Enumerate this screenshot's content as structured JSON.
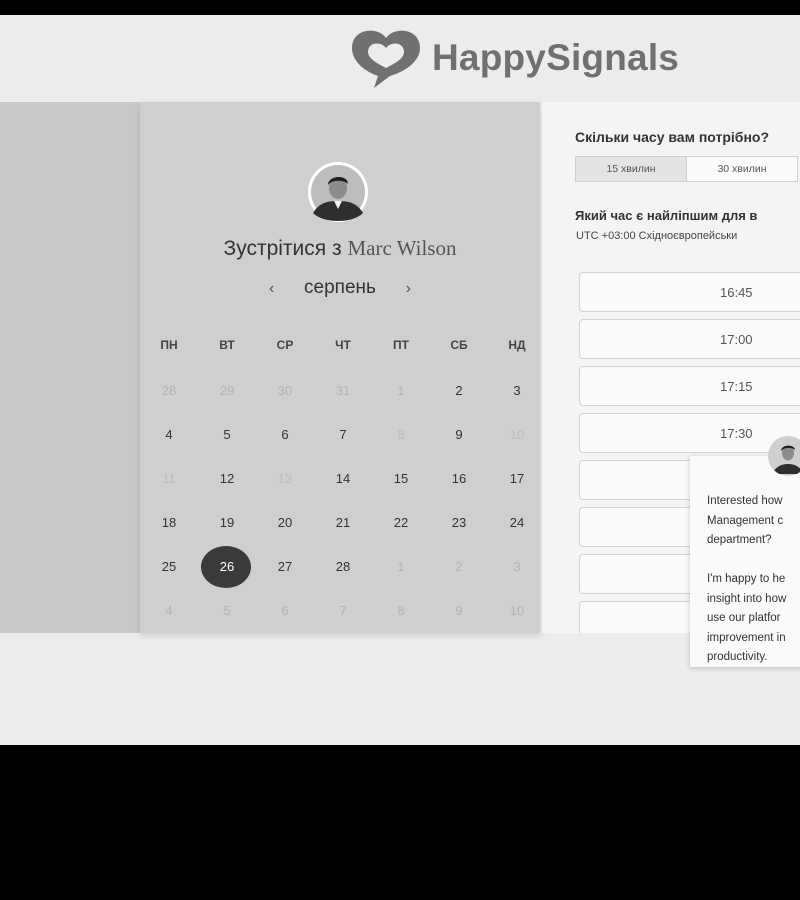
{
  "brand": {
    "name": "HappySignals"
  },
  "calendar": {
    "title_prefix": "Зустрітися з",
    "host_name": "Marc Wilson",
    "month": "серпень",
    "prev_label": "‹",
    "next_label": "›",
    "weekdays": [
      "ПН",
      "ВТ",
      "СР",
      "ЧТ",
      "ПТ",
      "СБ",
      "НД"
    ],
    "weeks": [
      [
        {
          "d": "28",
          "s": "muted"
        },
        {
          "d": "29",
          "s": "muted"
        },
        {
          "d": "30",
          "s": "muted"
        },
        {
          "d": "31",
          "s": "muted"
        },
        {
          "d": "1",
          "s": "muted"
        },
        {
          "d": "2",
          "s": "normal"
        },
        {
          "d": "3",
          "s": "normal"
        }
      ],
      [
        {
          "d": "4",
          "s": "normal"
        },
        {
          "d": "5",
          "s": "normal"
        },
        {
          "d": "6",
          "s": "normal"
        },
        {
          "d": "7",
          "s": "normal"
        },
        {
          "d": "8",
          "s": "disabled"
        },
        {
          "d": "9",
          "s": "normal"
        },
        {
          "d": "10",
          "s": "disabled"
        }
      ],
      [
        {
          "d": "11",
          "s": "disabled"
        },
        {
          "d": "12",
          "s": "normal"
        },
        {
          "d": "13",
          "s": "disabled"
        },
        {
          "d": "14",
          "s": "normal"
        },
        {
          "d": "15",
          "s": "normal"
        },
        {
          "d": "16",
          "s": "normal"
        },
        {
          "d": "17",
          "s": "normal"
        }
      ],
      [
        {
          "d": "18",
          "s": "normal"
        },
        {
          "d": "19",
          "s": "normal"
        },
        {
          "d": "20",
          "s": "normal"
        },
        {
          "d": "21",
          "s": "normal"
        },
        {
          "d": "22",
          "s": "normal"
        },
        {
          "d": "23",
          "s": "normal"
        },
        {
          "d": "24",
          "s": "normal"
        }
      ],
      [
        {
          "d": "25",
          "s": "normal"
        },
        {
          "d": "26",
          "s": "selected"
        },
        {
          "d": "27",
          "s": "normal"
        },
        {
          "d": "28",
          "s": "normal"
        },
        {
          "d": "1",
          "s": "muted"
        },
        {
          "d": "2",
          "s": "muted"
        },
        {
          "d": "3",
          "s": "muted"
        }
      ],
      [
        {
          "d": "4",
          "s": "muted"
        },
        {
          "d": "5",
          "s": "muted"
        },
        {
          "d": "6",
          "s": "muted"
        },
        {
          "d": "7",
          "s": "muted"
        },
        {
          "d": "8",
          "s": "muted"
        },
        {
          "d": "9",
          "s": "muted"
        },
        {
          "d": "10",
          "s": "muted"
        }
      ]
    ]
  },
  "scheduler": {
    "duration_question": "Скільки часу вам потрібно?",
    "durations": [
      {
        "label": "15 хвилин",
        "active": true
      },
      {
        "label": "30 хвилин",
        "active": false
      }
    ],
    "time_question": "Який час є найліпшим для в",
    "timezone": "UTC +03:00 Східноєвропейськи",
    "slots": [
      "16:45",
      "17:00",
      "17:15",
      "17:30",
      "",
      "",
      ""
    ]
  },
  "chat": {
    "lines_1": [
      "Interested how",
      "Management c",
      "department?"
    ],
    "lines_2": [
      "I'm happy to he",
      "insight into how",
      "use our platfor",
      "improvement in",
      "productivity."
    ]
  },
  "colors": {
    "selected_day": "#3a3a3a",
    "brand_gray": "#707070"
  }
}
